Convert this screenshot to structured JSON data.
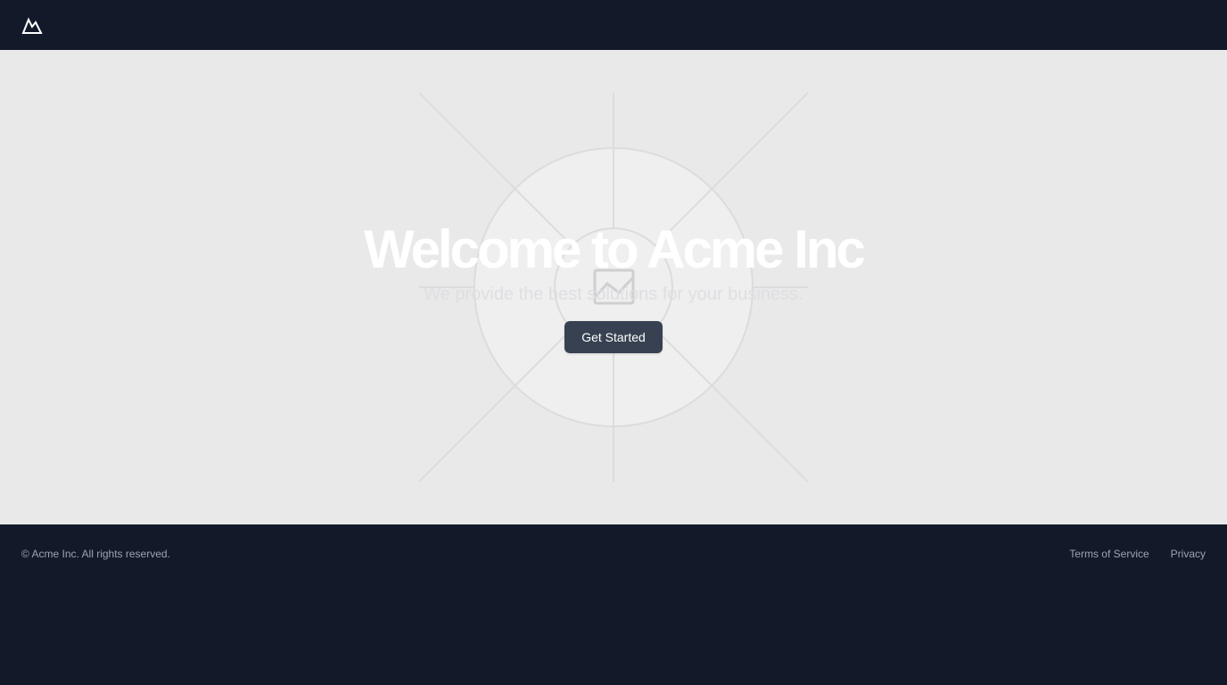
{
  "header": {
    "logo_icon": "mountain-icon"
  },
  "hero": {
    "title": "Welcome to Acme Inc",
    "subtitle": "We provide the best solutions for your business.",
    "cta_label": "Get Started",
    "placeholder_icon": "image-placeholder-icon"
  },
  "footer": {
    "copyright": "© Acme Inc. All rights reserved.",
    "links": [
      "Terms of Service",
      "Privacy"
    ]
  },
  "colors": {
    "nav_background": "#121a2a",
    "hero_background": "#e9e9e9",
    "button_background": "#374151",
    "footer_text": "#9ca3af"
  }
}
